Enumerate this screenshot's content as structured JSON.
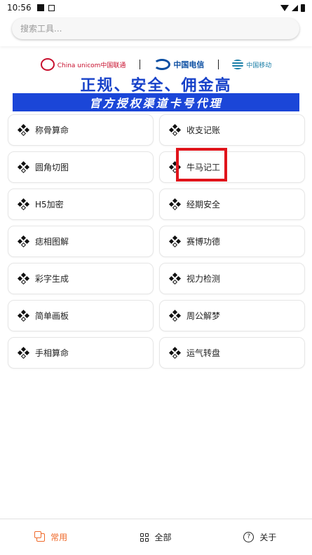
{
  "status_bar": {
    "time": "10:56"
  },
  "search": {
    "placeholder": "搜索工具..."
  },
  "banner": {
    "unicom": "China unicom中国联通",
    "telecom": "中国电信",
    "mobile": "中国移动",
    "headline": "正规、安全、佣金高",
    "subline": "官方授权渠道卡号代理"
  },
  "tools": [
    {
      "label": "称骨算命"
    },
    {
      "label": "收支记账"
    },
    {
      "label": "圆角切图"
    },
    {
      "label": "牛马记工"
    },
    {
      "label": "H5加密"
    },
    {
      "label": "经期安全"
    },
    {
      "label": "痣相图解"
    },
    {
      "label": "赛博功德"
    },
    {
      "label": "彩字生成"
    },
    {
      "label": "视力检测"
    },
    {
      "label": "简单画板"
    },
    {
      "label": "周公解梦"
    },
    {
      "label": "手相算命"
    },
    {
      "label": "运气转盘"
    }
  ],
  "bottom_nav": {
    "common": "常用",
    "all": "全部",
    "about": "关于",
    "active_color": "#ef6a2b"
  },
  "colors": {
    "highlight": "#e0141b",
    "banner_blue": "#1b46d8"
  }
}
